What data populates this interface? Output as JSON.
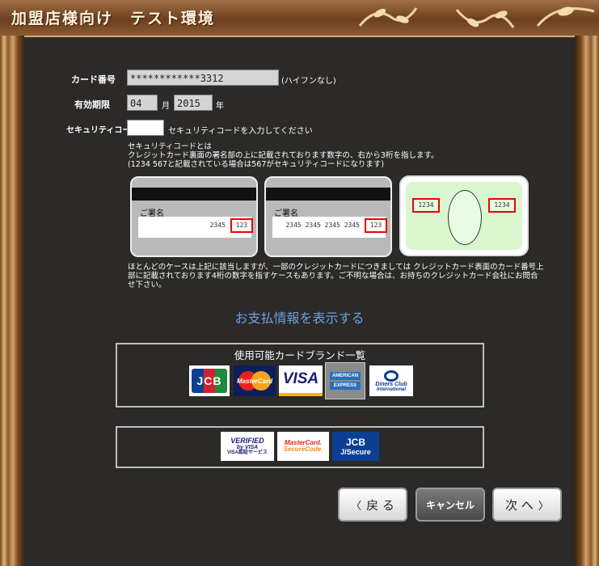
{
  "window": {
    "title": "加盟店様向け　テスト環境"
  },
  "form": {
    "card_number": {
      "label": "カード番号",
      "value": "************3312",
      "hint": "(ハイフンなし)"
    },
    "expiry": {
      "label": "有効期限",
      "month": "04",
      "month_unit": "月",
      "year": "2015",
      "year_unit": "年"
    },
    "security_code": {
      "label": "セキュリティコード",
      "value": "",
      "hint": "セキュリティコードを入力してください"
    }
  },
  "explanation": {
    "text": "セキュリティコードとは\nクレジットカード裏面の署名部の上に記載されております数字の、右から3桁を指します。\n(1234 567と記載されている場合は567がセキュリティコードになります)",
    "card1": {
      "sig_label": "ご署名",
      "numbers": "2345",
      "cvv": "123"
    },
    "card2": {
      "sig_label": "ご署名",
      "numbers": "2345 2345 2345 2345",
      "cvv": "123"
    },
    "card3": {
      "left_code": "1234",
      "right_code": "1234"
    },
    "footnote": "ほとんどのケースは上記に該当しますが、一部のクレジットカードにつきましては クレジットカード表面のカード番号上部に記載されております4桁の数字を指すケースもあります。ご不明な場合は、お持ちのクレジットカード会社にお問合せ下さい。"
  },
  "payment_link": "お支払情報を表示する",
  "brands": {
    "title": "使用可能カードブランド一覧",
    "logos": {
      "jcb": "JCB",
      "mastercard": "MasterCard",
      "visa": "VISA",
      "amex_top": "AMERICAN",
      "amex_bottom": "EXPRESS",
      "diners_top": "Diners Club",
      "diners_bottom": "International"
    }
  },
  "secure_logos": {
    "verified_line1": "VERIFIED",
    "verified_line2": "by VISA",
    "verified_line3": "VISA認証サービス",
    "mc_line1": "MasterCard.",
    "mc_line2": "SecureCode.",
    "jcb_line1": "JCB",
    "jcb_line2": "J/Secure"
  },
  "buttons": {
    "back": "戻 る",
    "cancel": "キャンセル",
    "next": "次 へ"
  },
  "colors": {
    "accent_link": "#6fa0e0",
    "cvv_highlight": "#ee0000",
    "amex_bg": "#d9f6cf"
  }
}
